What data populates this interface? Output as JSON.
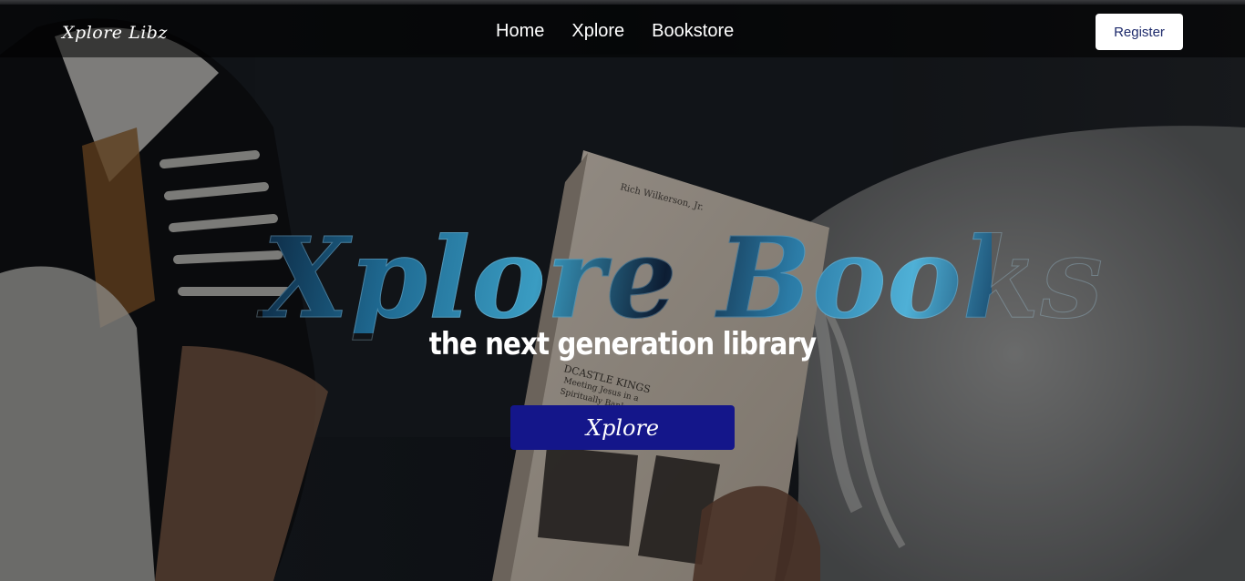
{
  "navbar": {
    "brand": "Xplore Libz",
    "links": [
      {
        "label": "Home"
      },
      {
        "label": "Xplore"
      },
      {
        "label": "Bookstore"
      }
    ],
    "register_label": "Register"
  },
  "hero": {
    "title": "Xplore Books",
    "tagline": "the next generation library",
    "cta_label": "Xplore",
    "background_image": "photo-of-sneakers-and-open-book-on-blanket",
    "cta_color": "#14168a"
  }
}
